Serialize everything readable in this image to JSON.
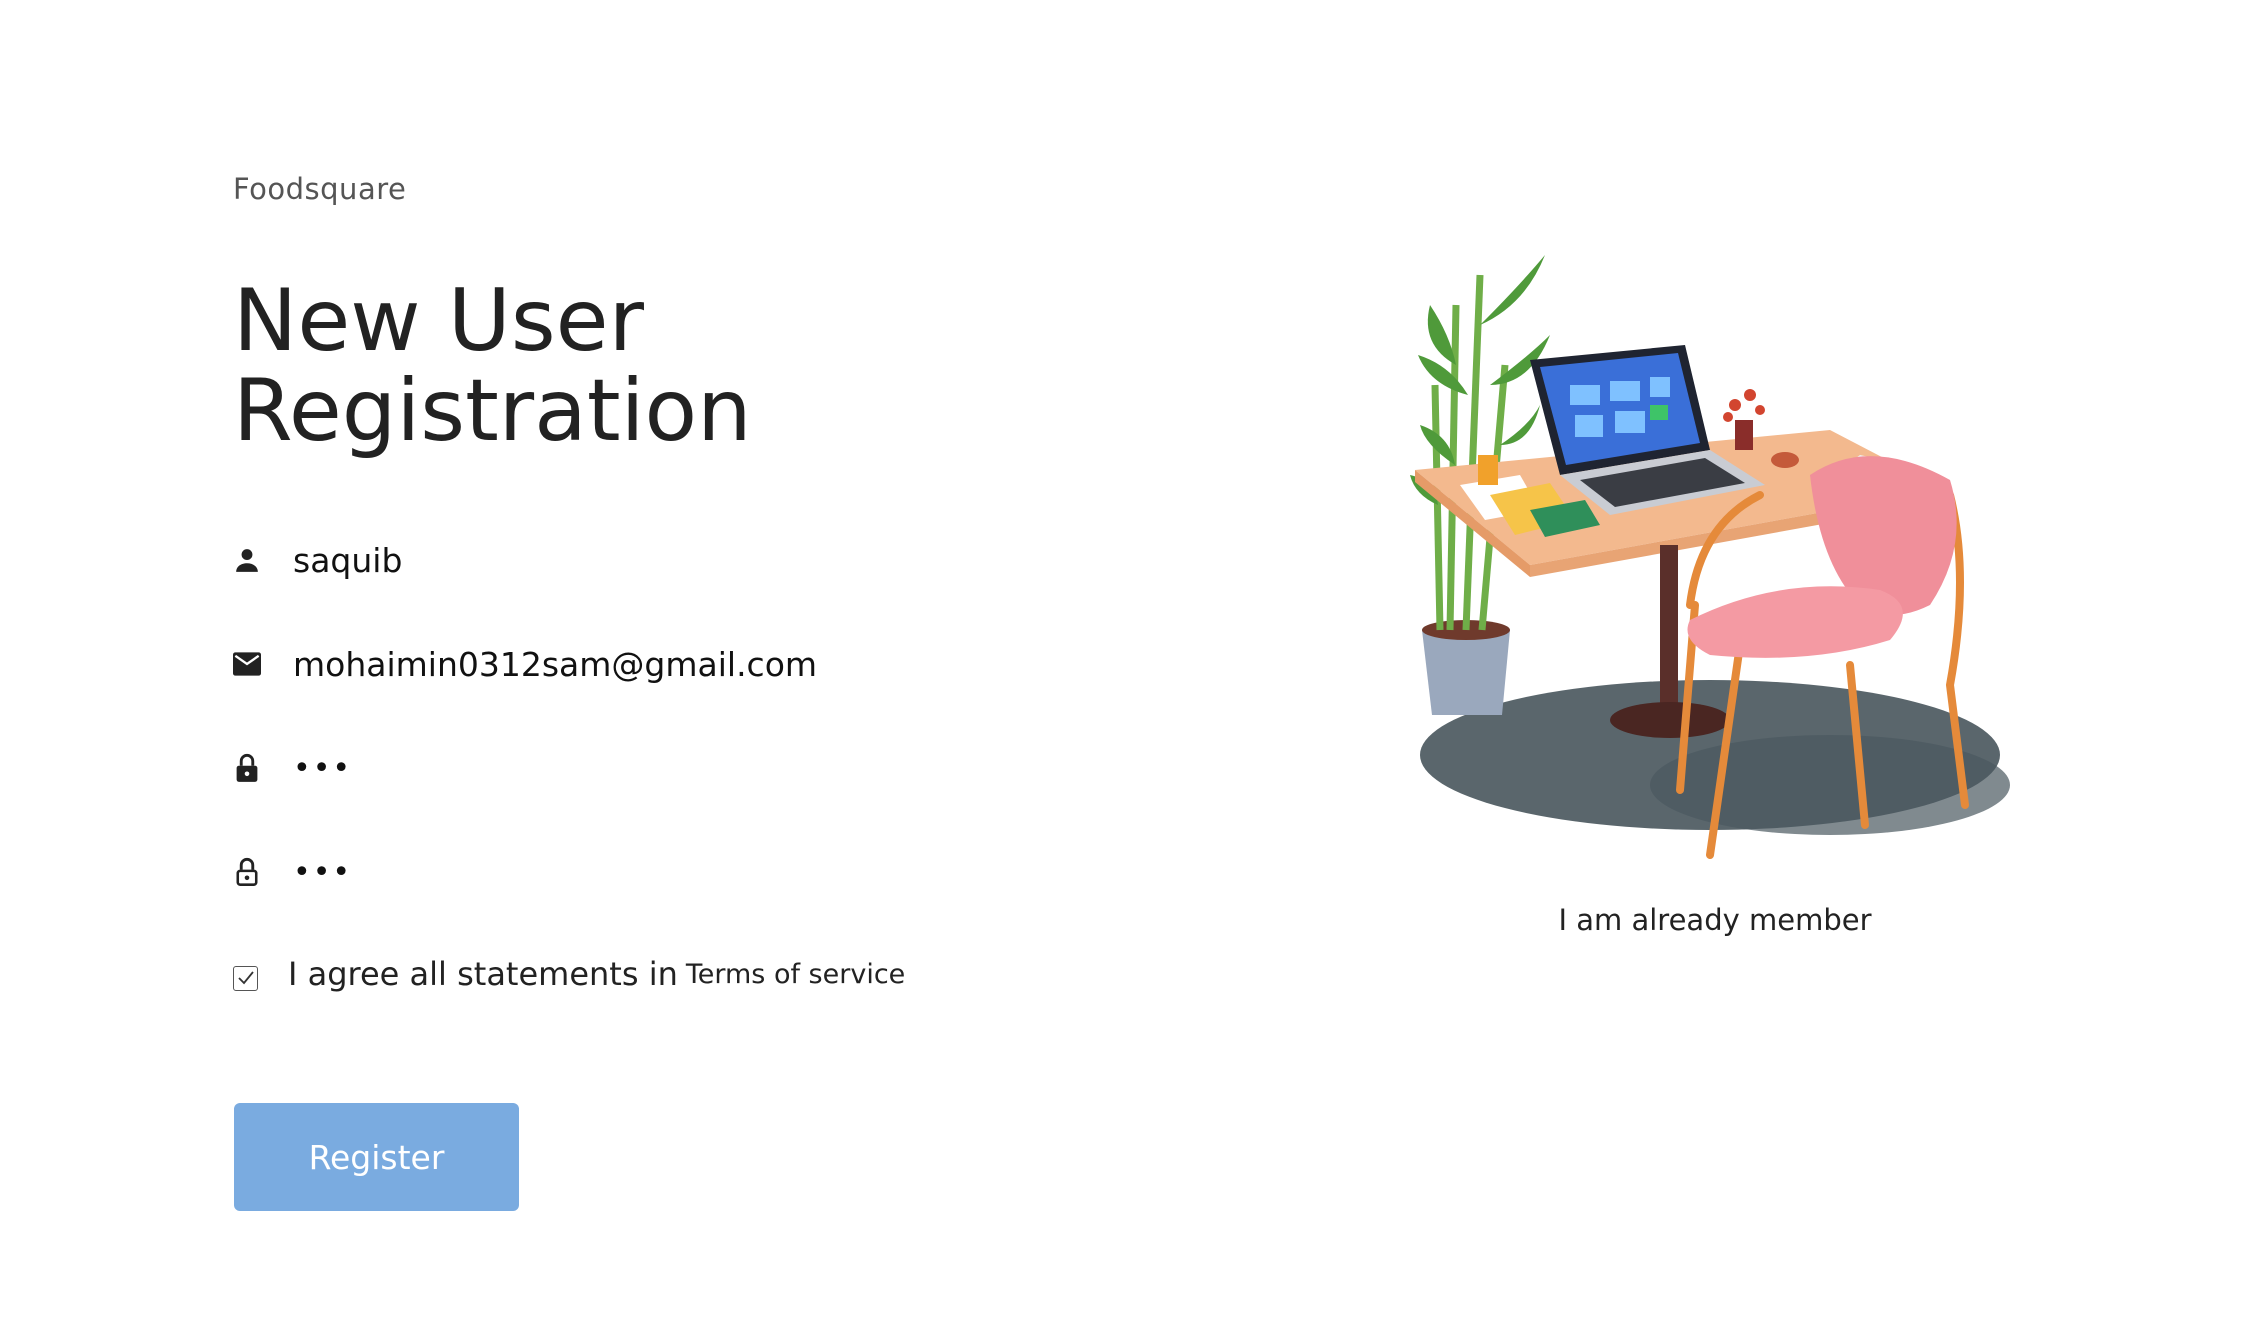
{
  "brand": "Foodsquare",
  "title": "New User Registration",
  "form": {
    "name_value": "saquib",
    "email_value": "mohaimin0312sam@gmail.com",
    "password_value": "•••",
    "repeat_password_value": "•••",
    "agree_text": "I agree all statements in",
    "terms_link": "Terms of service",
    "terms_checked": true,
    "register_label": "Register"
  },
  "side": {
    "member_link": "I am already member"
  },
  "icons": {
    "name": "person-icon",
    "email": "envelope-icon",
    "password": "lock-icon",
    "repeat_password": "lock-outline-icon",
    "checkbox": "check-icon"
  },
  "colors": {
    "button": "#7aabe0",
    "text": "#222222",
    "brand_text": "#555555"
  }
}
